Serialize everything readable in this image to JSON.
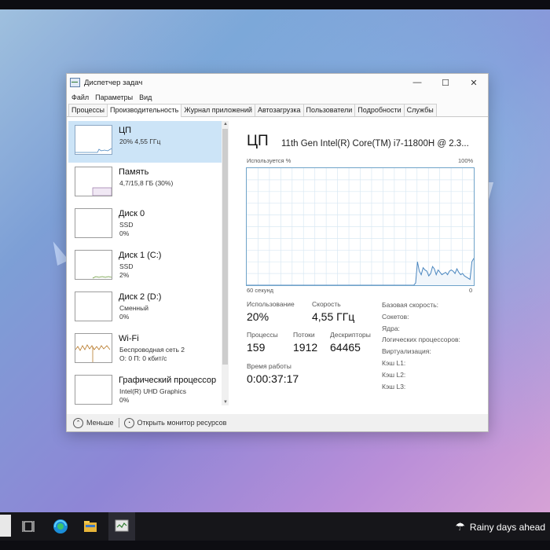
{
  "window": {
    "title": "Диспетчер задач",
    "menu": [
      "Файл",
      "Параметры",
      "Вид"
    ],
    "tabs": [
      "Процессы",
      "Производительность",
      "Журнал приложений",
      "Автозагрузка",
      "Пользователи",
      "Подробности",
      "Службы"
    ],
    "active_tab": "Производительность",
    "min_label": "—",
    "max_label": "☐",
    "close_label": "✕"
  },
  "sidebar": [
    {
      "name": "ЦП",
      "sub1": "20% 4,55 ГГц",
      "sub2": "",
      "selected": true
    },
    {
      "name": "Память",
      "sub1": "4,7/15,8 ГБ (30%)",
      "sub2": ""
    },
    {
      "name": "Диск 0",
      "sub1": "SSD",
      "sub2": "0%"
    },
    {
      "name": "Диск 1 (C:)",
      "sub1": "SSD",
      "sub2": "2%"
    },
    {
      "name": "Диск 2 (D:)",
      "sub1": "Сменный",
      "sub2": "0%"
    },
    {
      "name": "Wi-Fi",
      "sub1": "Беспроводная сеть 2",
      "sub2": "О: 0 П: 0 кбит/с"
    },
    {
      "name": "Графический процессор",
      "sub1": "Intel(R) UHD Graphics",
      "sub2": "0%"
    }
  ],
  "detail": {
    "title": "ЦП",
    "model": "11th Gen Intel(R) Core(TM) i7-11800H @ 2.3...",
    "graph_label": "Используется %",
    "graph_max": "100%",
    "graph_time": "60 секунд",
    "graph_min": "0",
    "usage_label": "Использование",
    "usage_value": "20%",
    "speed_label": "Скорость",
    "speed_value": "4,55 ГГц",
    "processes_label": "Процессы",
    "processes_value": "159",
    "threads_label": "Потоки",
    "threads_value": "1912",
    "handles_label": "Дескрипторы",
    "handles_value": "64465",
    "uptime_label": "Время работы",
    "uptime_value": "0:00:37:17",
    "props": [
      "Базовая скорость:",
      "Сокетов:",
      "Ядра:",
      "Логических процессоров:",
      "Виртуализация:",
      "Кэш L1:",
      "Кэш L2:",
      "Кэш L3:"
    ]
  },
  "footer": {
    "less": "Меньше",
    "monitor": "Открыть монитор ресурсов"
  },
  "taskbar": {
    "weather": "Rainy days ahead"
  },
  "chart_data": {
    "type": "area",
    "title": "",
    "xlabel": "60 секунд",
    "ylabel": "Используется %",
    "ylim": [
      0,
      100
    ],
    "x": [
      0,
      2,
      4,
      6,
      8,
      10,
      12,
      14,
      16,
      18,
      20,
      22,
      24,
      26,
      28,
      30,
      32,
      34,
      36,
      38,
      40,
      42,
      44,
      46,
      48,
      50,
      52,
      54,
      56,
      58,
      60
    ],
    "series": [
      {
        "values": [
          null,
          null,
          null,
          null,
          null,
          null,
          null,
          null,
          null,
          null,
          null,
          null,
          null,
          null,
          null,
          null,
          null,
          null,
          null,
          null,
          null,
          null,
          null,
          null,
          null,
          null,
          null,
          null,
          null,
          null,
          null
        ]
      }
    ]
  },
  "cpu_history": [
    0,
    0,
    0,
    0,
    0,
    0,
    0,
    0,
    0,
    0,
    0,
    0,
    0,
    0,
    0,
    0,
    0,
    0,
    0,
    0,
    0,
    0,
    0,
    0,
    0,
    0,
    0,
    0,
    0,
    0,
    0,
    0,
    0,
    0,
    0,
    0,
    0,
    0,
    0,
    0,
    0,
    0,
    0,
    0,
    0,
    0,
    0,
    0,
    0,
    0,
    0,
    0,
    0,
    0,
    0,
    0,
    0,
    0,
    0,
    0,
    0,
    0,
    0,
    0,
    0,
    0,
    0,
    0,
    0,
    0,
    0,
    0,
    0,
    0,
    0,
    0,
    0,
    0,
    0,
    0,
    0,
    0,
    0,
    0,
    0,
    0,
    0,
    0,
    0,
    0,
    2,
    20,
    12,
    9,
    15,
    13,
    12,
    8,
    10,
    16,
    14,
    9,
    13,
    11,
    9,
    10,
    11,
    9,
    12,
    13,
    12,
    10,
    14,
    11,
    9,
    10,
    8,
    7,
    6,
    5,
    20,
    23
  ]
}
